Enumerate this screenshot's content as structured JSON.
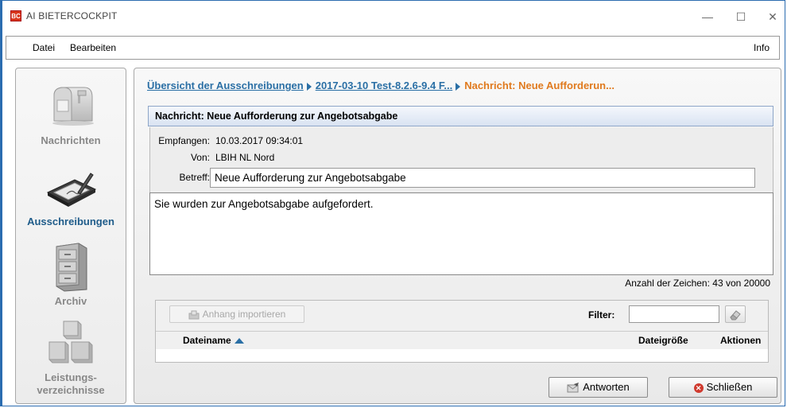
{
  "window": {
    "app_icon_text": "BC",
    "title": "AI BIETERCOCKPIT",
    "minimize": "—",
    "maximize": "☐",
    "close": "✕"
  },
  "menu": {
    "datei": "Datei",
    "bearbeiten": "Bearbeiten",
    "info": "Info"
  },
  "sidebar": {
    "items": [
      {
        "label": "Nachrichten",
        "icon": "mailbox-icon"
      },
      {
        "label": "Ausschreibungen",
        "icon": "signing-tablet-icon",
        "active": true
      },
      {
        "label": "Archiv",
        "icon": "filing-cabinet-icon"
      },
      {
        "label": "Leistungs-\nverzeichnisse",
        "icon": "boxes-icon"
      }
    ]
  },
  "breadcrumb": {
    "item1": "Übersicht der Ausschreibungen",
    "item2": "2017-03-10  Test-8.2.6-9.4  F...",
    "current": "Nachricht: Neue Aufforderun..."
  },
  "message": {
    "header": "Nachricht: Neue Aufforderung zur Angebotsabgabe",
    "received_label": "Empfangen:",
    "received_value": "10.03.2017 09:34:01",
    "from_label": "Von:",
    "from_value": "LBIH NL Nord",
    "subject_label": "Betreff:",
    "subject_value": "Neue Aufforderung zur Angebotsabgabe",
    "body": "Sie wurden zur Angebotsabgabe aufgefordert.",
    "char_count": "Anzahl der Zeichen: 43 von 20000"
  },
  "attachments": {
    "import_button": "Anhang importieren",
    "filter_label": "Filter:",
    "filter_value": "",
    "columns": {
      "filename": "Dateiname",
      "filesize": "Dateigröße",
      "actions": "Aktionen"
    },
    "rows": []
  },
  "actions": {
    "reply": "Antworten",
    "close": "Schließen"
  },
  "colors": {
    "accent": "#2a6fa5",
    "current": "#e07a1e",
    "active_sidebar": "#1f5c8a"
  }
}
